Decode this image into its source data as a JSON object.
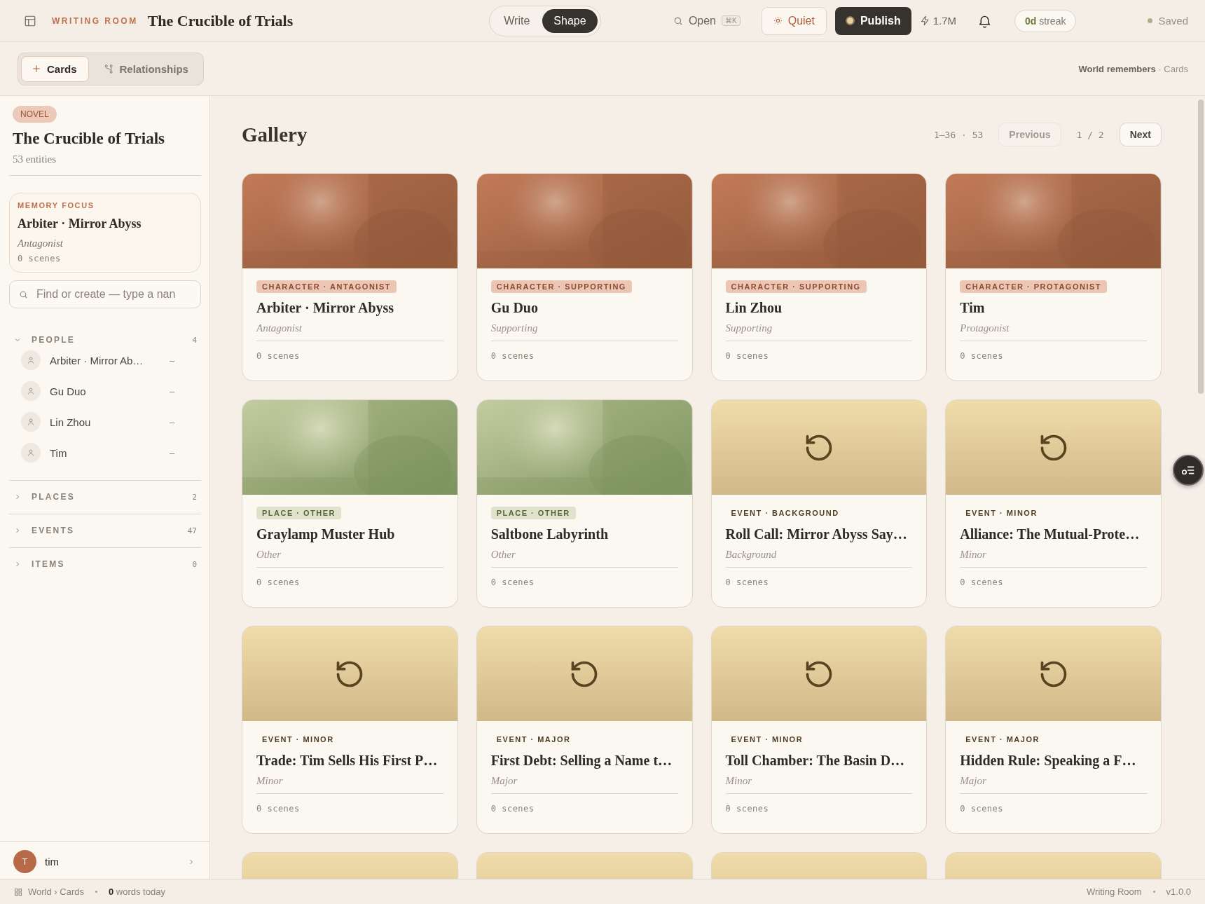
{
  "top_bar": {
    "section_label": "WRITING ROOM",
    "title": "The Crucible of Trials",
    "modes": [
      {
        "label": "Write",
        "selected": false
      },
      {
        "label": "Shape",
        "selected": true
      }
    ],
    "open": {
      "label": "Open",
      "shortcut": "⌘K"
    },
    "quiet_button": "Quiet",
    "publish_button": "Publish",
    "word_count": "1.7M",
    "streak": {
      "value": "0d",
      "label": "streak"
    },
    "save_status": "Saved"
  },
  "view_tabs": [
    {
      "label": "Cards",
      "selected": true
    },
    {
      "label": "Relationships",
      "selected": false
    }
  ],
  "breadcrumb": "**World remembers** · Cards",
  "sidebar": {
    "badge": "NOVEL",
    "title": "The Crucible of Trials",
    "count": "53 entities",
    "memory_focus": {
      "label": "MEMORY FOCUS",
      "name": "Arbiter · Mirror Abyss",
      "role": "Antagonist",
      "scenes": "0 scenes"
    },
    "search": {
      "placeholder": "Find or create — type a nan"
    },
    "groups": [
      {
        "label": "PEOPLE",
        "count": "4",
        "expanded": true,
        "children": [
          {
            "name": "Arbiter · Mirror Ab…",
            "value": "–"
          },
          {
            "name": "Gu Duo",
            "value": "–"
          },
          {
            "name": "Lin Zhou",
            "value": "–"
          },
          {
            "name": "Tim",
            "value": "–"
          }
        ]
      },
      {
        "label": "PLACES",
        "count": "2",
        "expanded": false
      },
      {
        "label": "EVENTS",
        "count": "47",
        "expanded": false
      },
      {
        "label": "ITEMS",
        "count": "0",
        "expanded": false
      }
    ],
    "user": {
      "initial": "T",
      "name": "tim"
    }
  },
  "gallery": {
    "title": "Gallery",
    "range": "1–36 · 53",
    "previous": {
      "label": "Previous",
      "disabled": true
    },
    "page": "1 / 2",
    "next": {
      "label": "Next",
      "disabled": false
    },
    "cards": [
      {
        "kind": "character",
        "tag": "CHARACTER · ANTAGONIST",
        "name": "Arbiter · Mirror Abyss",
        "role": "Antagonist",
        "scenes": "0 scenes"
      },
      {
        "kind": "character",
        "tag": "CHARACTER · SUPPORTING",
        "name": "Gu Duo",
        "role": "Supporting",
        "scenes": "0 scenes"
      },
      {
        "kind": "character",
        "tag": "CHARACTER · SUPPORTING",
        "name": "Lin Zhou",
        "role": "Supporting",
        "scenes": "0 scenes"
      },
      {
        "kind": "character",
        "tag": "CHARACTER · PROTAGONIST",
        "name": "Tim",
        "role": "Protagonist",
        "scenes": "0 scenes"
      },
      {
        "kind": "place",
        "tag": "PLACE · OTHER",
        "name": "Graylamp Muster Hub",
        "role": "Other",
        "scenes": "0 scenes"
      },
      {
        "kind": "place",
        "tag": "PLACE · OTHER",
        "name": "Saltbone Labyrinth",
        "role": "Other",
        "scenes": "0 scenes"
      },
      {
        "kind": "event",
        "tag": "EVENT · BACKGROUND",
        "name": "Roll Call: Mirror Abyss Say…",
        "role": "Background",
        "scenes": "0 scenes"
      },
      {
        "kind": "event",
        "tag": "EVENT · MINOR",
        "name": "Alliance: The Mutual-Prote…",
        "role": "Minor",
        "scenes": "0 scenes"
      },
      {
        "kind": "event",
        "tag": "EVENT · MINOR",
        "name": "Trade: Tim Sells His First P…",
        "role": "Minor",
        "scenes": "0 scenes"
      },
      {
        "kind": "event",
        "tag": "EVENT · MAJOR",
        "name": "First Debt: Selling a Name t…",
        "role": "Major",
        "scenes": "0 scenes"
      },
      {
        "kind": "event",
        "tag": "EVENT · MINOR",
        "name": "Toll Chamber: The Basin D…",
        "role": "Minor",
        "scenes": "0 scenes"
      },
      {
        "kind": "event",
        "tag": "EVENT · MAJOR",
        "name": "Hidden Rule: Speaking a F…",
        "role": "Major",
        "scenes": "0 scenes"
      },
      {
        "kind": "event"
      },
      {
        "kind": "event"
      },
      {
        "kind": "event"
      },
      {
        "kind": "event"
      }
    ]
  },
  "status_bar": {
    "location": "World › Cards",
    "words_today": "**0** words today",
    "app_name": "Writing Room",
    "version": "v1.0.0"
  }
}
